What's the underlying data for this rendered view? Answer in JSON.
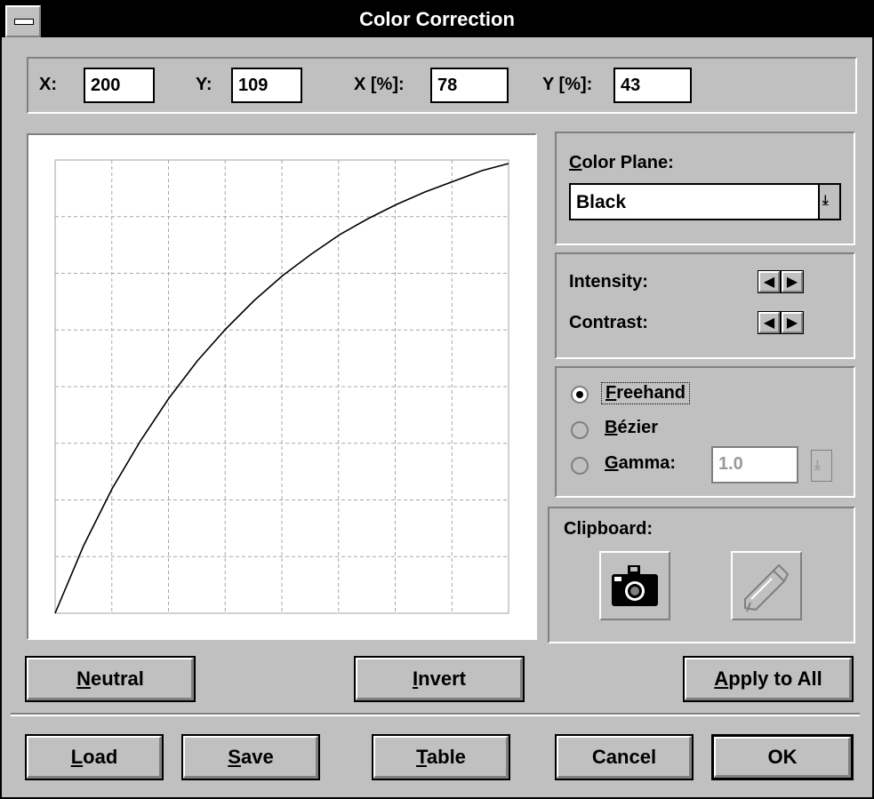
{
  "window": {
    "title": "Color Correction"
  },
  "coords": {
    "x_label": "X:",
    "x_value": "200",
    "y_label": "Y:",
    "y_value": "109",
    "xp_label": "X [%]:",
    "xp_value": "78",
    "yp_label": "Y [%]:",
    "yp_value": "43"
  },
  "color_plane": {
    "label": "Color Plane:",
    "selected": "Black"
  },
  "adjust": {
    "intensity_label": "Intensity:",
    "contrast_label": "Contrast:"
  },
  "curve_mode": {
    "freehand_label": "Freehand",
    "bezier_label": "Bézier",
    "gamma_label": "Gamma:",
    "gamma_value": "1.0",
    "selected": "freehand"
  },
  "clipboard": {
    "label": "Clipboard:",
    "copy_icon": "camera-icon",
    "paste_icon": "paste-tube-icon"
  },
  "buttons": {
    "neutral": "Neutral",
    "invert": "Invert",
    "apply_all": "Apply to All",
    "load": "Load",
    "save": "Save",
    "table": "Table",
    "cancel": "Cancel",
    "ok": "OK"
  },
  "chart_data": {
    "type": "line",
    "title": "",
    "grid": true,
    "xlim": [
      0,
      255
    ],
    "ylim": [
      0,
      255
    ],
    "series": [
      {
        "x": [
          0,
          16,
          32,
          48,
          64,
          80,
          96,
          112,
          128,
          144,
          160,
          176,
          192,
          208,
          224,
          240,
          255
        ],
        "y": [
          0,
          38,
          70,
          97,
          121,
          142,
          160,
          176,
          190,
          202,
          213,
          222,
          230,
          237,
          243,
          249,
          253
        ]
      }
    ]
  }
}
